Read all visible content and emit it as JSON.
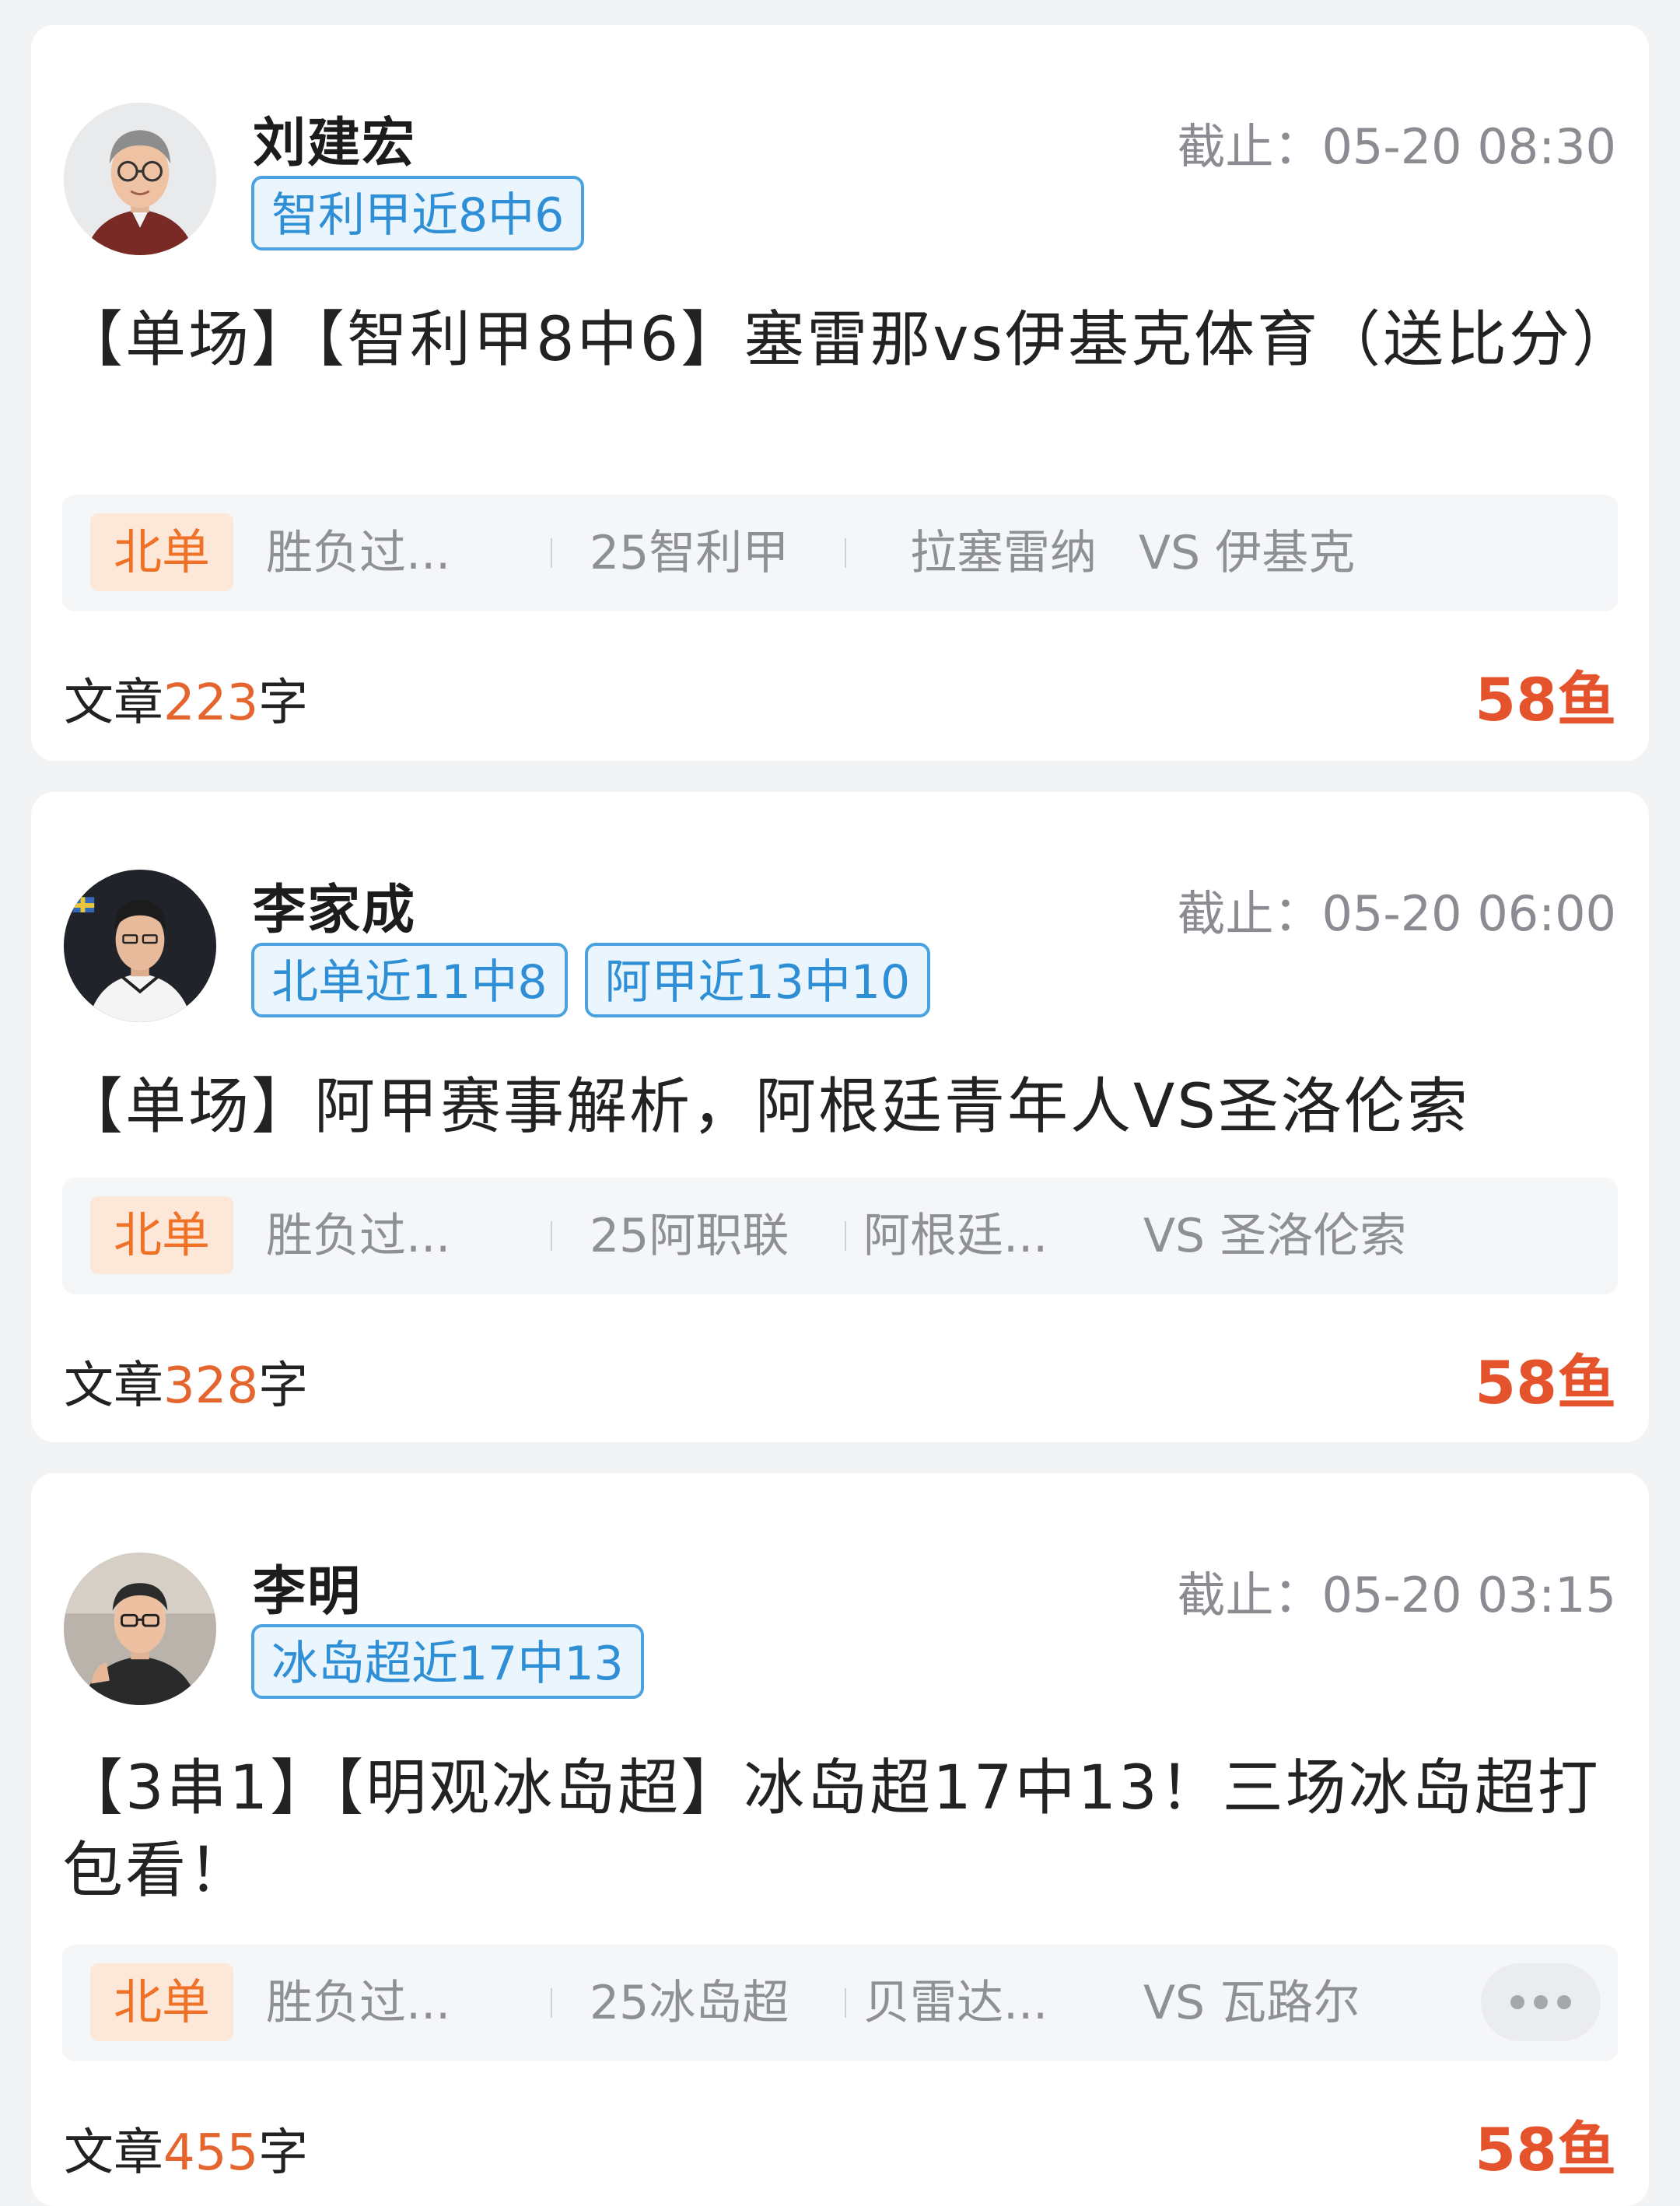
{
  "articles": [
    {
      "author": "刘建宏",
      "tags": [
        "智利甲近8中6"
      ],
      "deadline": "截止：05-20 08:30",
      "title": "【单场】【智利甲8中6】塞雷那vs伊基克体育（送比分）",
      "match": {
        "lottery": "北单",
        "play": "胜负过...",
        "league": "25智利甲",
        "home": "拉塞雷纳",
        "vs_away": "VS 伊基克"
      },
      "word_prefix": "文章",
      "word_count": "223",
      "word_suffix": "字",
      "price": "58鱼",
      "avatar_icon": "avatar-man-glasses-icon"
    },
    {
      "author": "李家成",
      "tags": [
        "北单近11中8",
        "阿甲近13中10"
      ],
      "deadline": "截止：05-20 06:00",
      "title": "【单场】阿甲赛事解析，阿根廷青年人VS圣洛伦索",
      "match": {
        "lottery": "北单",
        "play": "胜负过...",
        "league": "25阿职联",
        "home": "阿根廷...",
        "vs_away": "VS 圣洛伦索"
      },
      "word_prefix": "文章",
      "word_count": "328",
      "word_suffix": "字",
      "price": "58鱼",
      "avatar_icon": "avatar-young-man-icon"
    },
    {
      "author": "李明",
      "tags": [
        "冰岛超近17中13"
      ],
      "deadline": "截止：05-20 03:15",
      "title": "【3串1】【明观冰岛超】冰岛超17中13！三场冰岛超打包看！",
      "match": {
        "lottery": "北单",
        "play": "胜负过...",
        "league": "25冰岛超",
        "home": "贝雷达...",
        "vs_away": "VS 瓦路尔"
      },
      "word_prefix": "文章",
      "word_count": "455",
      "word_suffix": "字",
      "price": "58鱼",
      "avatar_icon": "avatar-man-glasses-icon"
    }
  ],
  "colors": {
    "tag_border": "#4aa3e0",
    "tag_text": "#2e8fd6",
    "lottery_badge_bg": "#fde7d8",
    "lottery_badge_text": "#f07227",
    "price": "#e4532c",
    "word_count_num": "#e5652f"
  }
}
